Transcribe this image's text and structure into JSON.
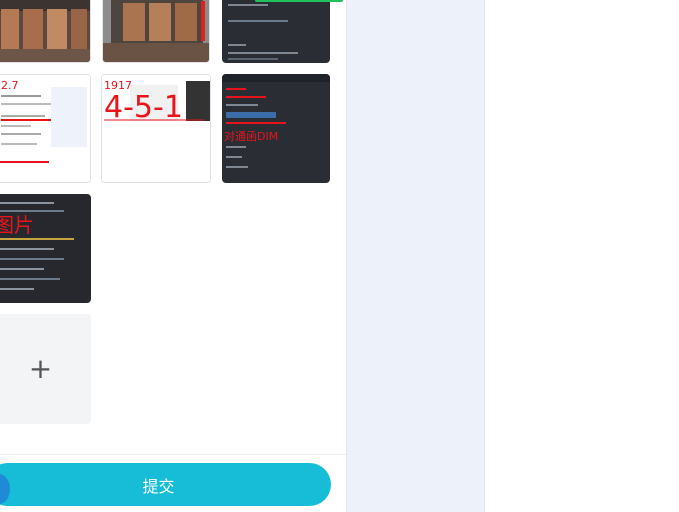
{
  "upload": {
    "add_icon": "plus-icon",
    "images": [
      {
        "name": "container-photo-1"
      },
      {
        "name": "container-photo-2"
      },
      {
        "name": "code-screenshot-1"
      },
      {
        "name": "document-screenshot-1",
        "overlay_text": "2.7"
      },
      {
        "name": "label-photo",
        "overlay_text": "4-5-1",
        "side_text": "1917"
      },
      {
        "name": "code-screenshot-2",
        "overlay_text": "对通函DIM"
      },
      {
        "name": "code-screenshot-3",
        "overlay_text": "图片"
      }
    ]
  },
  "footer": {
    "submit_label": "提交"
  },
  "colors": {
    "accent": "#17bcd6",
    "success": "#21c25e",
    "mid_panel": "#edf1f9"
  }
}
